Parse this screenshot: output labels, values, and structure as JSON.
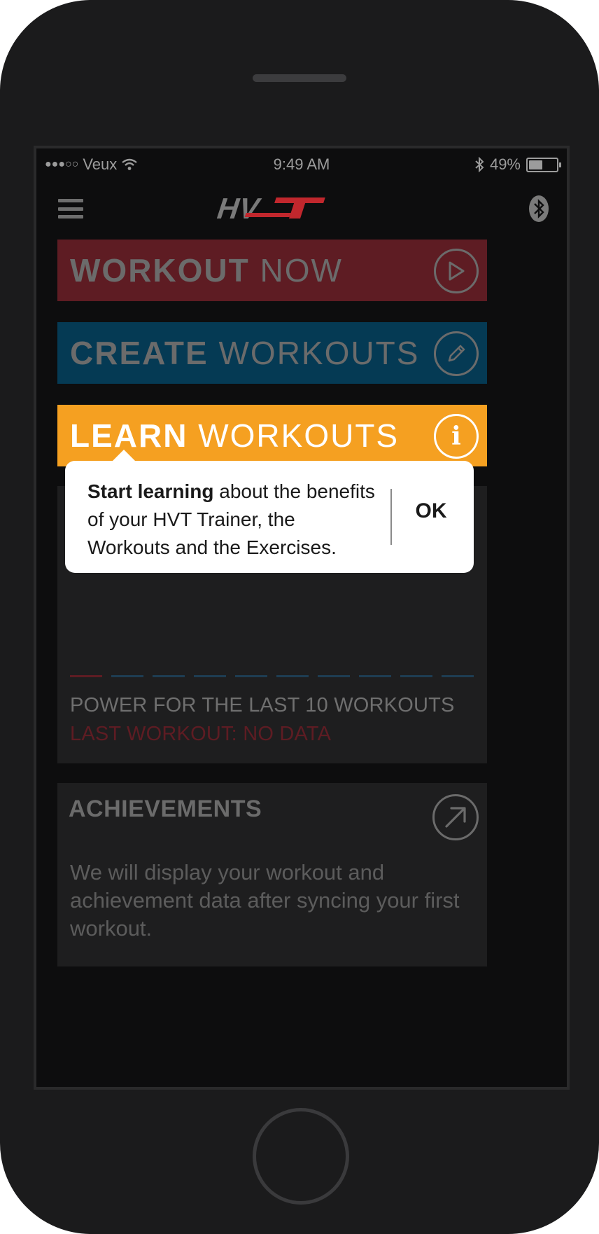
{
  "status_bar": {
    "carrier": "Veux",
    "time": "9:49 AM",
    "battery": "49%",
    "battery_level": 0.49
  },
  "nav": {
    "logo_text": "HVT"
  },
  "tiles": [
    {
      "bold": "WORKOUT",
      "thin": "NOW",
      "icon": "play-icon"
    },
    {
      "bold": "CREATE",
      "thin": "WORKOUTS",
      "icon": "pencil-icon"
    },
    {
      "bold": "LEARN",
      "thin": "WORKOUTS",
      "icon": "info-icon",
      "icon_glyph": "i"
    }
  ],
  "popover": {
    "bold": "Start learning",
    "text": " about the benefits of your HVT Trainer, the Workouts and the Exercises.",
    "ok_label": "OK"
  },
  "power": {
    "title": "POWER FOR THE LAST 10 WORKOUTS",
    "last_workout": "LAST WORKOUT:  NO DATA",
    "dash_count": 10
  },
  "achievements": {
    "title": "ACHIEVEMENTS",
    "text": "We will display your workout and achievement data after syncing your first workout.",
    "icon": "arrow-up-right-icon"
  },
  "colors": {
    "workout_now": "#5e1c23",
    "create": "#053a54",
    "learn": "#f5a021",
    "logo_red": "#c1272d"
  }
}
